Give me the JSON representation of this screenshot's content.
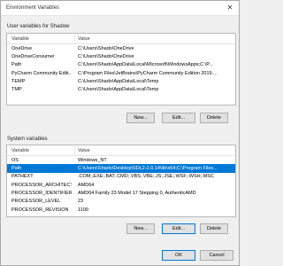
{
  "window": {
    "title": "Environment Variables",
    "close_glyph": "✕"
  },
  "user_section": {
    "label": "User variables for Shadow",
    "columns": [
      "Variable",
      "Value"
    ],
    "rows": [
      {
        "variable": "OneDrive",
        "value": "C:\\Users\\Shado\\OneDrive"
      },
      {
        "variable": "OneDriveConsumer",
        "value": "C:\\Users\\Shado\\OneDrive"
      },
      {
        "variable": "Path",
        "value": "C:\\Users\\Shado\\AppData\\Local\\Microsoft\\WindowsApps;C:\\P..."
      },
      {
        "variable": "PyCharm Community Editi...",
        "value": "C:\\Program Files\\JetBrains\\PyCharm Community Edition 2019...."
      },
      {
        "variable": "TEMP",
        "value": "C:\\Users\\Shado\\AppData\\Local\\Temp"
      },
      {
        "variable": "TMP",
        "value": "C:\\Users\\Shado\\AppData\\Local\\Temp"
      }
    ],
    "buttons": {
      "new": "New...",
      "edit": "Edit...",
      "delete": "Delete"
    }
  },
  "system_section": {
    "label": "System variables",
    "columns": [
      "Variable",
      "Value"
    ],
    "rows": [
      {
        "variable": "OS",
        "value": "Windows_NT",
        "selected": false
      },
      {
        "variable": "Path",
        "value": "C:\\Users\\Shado\\Desktop\\SDL2-2.0.14\\lib\\x64;C:\\Program Files...",
        "selected": true
      },
      {
        "variable": "PATHEXT",
        "value": ".COM;.EXE;.BAT;.CMD;.VBS;.VBE;.JS;.JSE;.WSF;.WSH;.MSC",
        "selected": false
      },
      {
        "variable": "PROCESSOR_ARCHITECTU...",
        "value": "AMD64",
        "selected": false
      },
      {
        "variable": "PROCESSOR_IDENTIFIER",
        "value": "AMD64 Family 23 Model 17 Stepping 0, AuthenticAMD",
        "selected": false
      },
      {
        "variable": "PROCESSOR_LEVEL",
        "value": "23",
        "selected": false
      },
      {
        "variable": "PROCESSOR_REVISION",
        "value": "1100",
        "selected": false
      }
    ],
    "buttons": {
      "new": "New...",
      "edit": "Edit...",
      "delete": "Delete"
    }
  },
  "footer": {
    "ok": "OK",
    "cancel": "Cancel"
  },
  "colors": {
    "selection": "#0078d7",
    "button": "#e1e1e1",
    "background": "#f0f0f0"
  }
}
